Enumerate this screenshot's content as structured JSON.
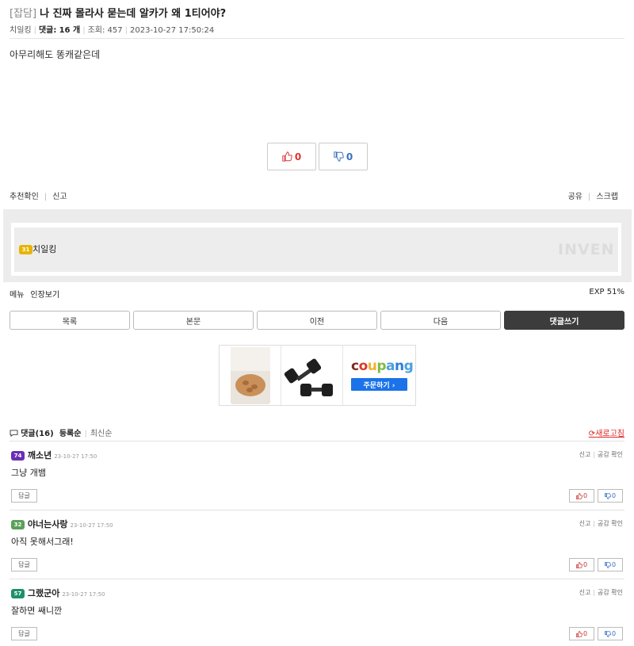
{
  "post": {
    "category": "[잡담]",
    "title": "나 진짜 몰라사 묻는데 알카가 왜 1티어야?",
    "author": "치일킹",
    "comments_label": "댓글:",
    "comments_count": "16 개",
    "views_label": "조회:",
    "views": "457",
    "datetime": "2023-10-27 17:50:24",
    "body": "아무리해도 똥캐같은데",
    "upvotes": "0",
    "downvotes": "0"
  },
  "utility": {
    "recommend_check": "추천확인",
    "report": "신고",
    "share": "공유",
    "scrap": "스크랩"
  },
  "profile": {
    "level": "31",
    "level_color": "#e8b400",
    "nickname": "치일킹",
    "watermark": "INVEN",
    "menu": "메뉴",
    "inventory": "인장보기",
    "exp": "EXP 51%"
  },
  "nav": {
    "list": "목록",
    "content": "본문",
    "prev": "이전",
    "next": "다음",
    "write_comment": "댓글쓰기"
  },
  "ad": {
    "brand": "coupang",
    "cta": "주문하기 ›",
    "product1": "ROASTED ALMONDS",
    "product2": "dumbbells"
  },
  "comments_header": {
    "title": "댓글",
    "count": "(16)",
    "sort_registered": "등록순",
    "sort_latest": "최신순",
    "refresh": "새로고침"
  },
  "comments": [
    {
      "level": "74",
      "level_color": "#6a2fb5",
      "nick": "깨소년",
      "date": "23-10-27 17:50",
      "text": "그냥 개뱀",
      "report": "신고",
      "empathy": "공감 확인",
      "reply": "답글",
      "up": "0",
      "down": "0"
    },
    {
      "level": "32",
      "level_color": "#5aa05a",
      "nick": "야너는사랑",
      "date": "23-10-27 17:50",
      "text": "아직 못해서그래!",
      "report": "신고",
      "empathy": "공감 확인",
      "reply": "답글",
      "up": "0",
      "down": "0"
    },
    {
      "level": "57",
      "level_color": "#1f8f6a",
      "nick": "그랬군아",
      "date": "23-10-27 17:50",
      "text": "잘하면 쌔니깐",
      "report": "신고",
      "empathy": "공감 확인",
      "reply": "답글",
      "up": "0",
      "down": "0"
    }
  ]
}
